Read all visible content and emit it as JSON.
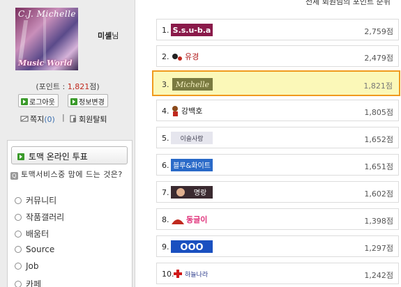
{
  "header": {
    "title": "전체 회원님의 포인트 순위"
  },
  "user": {
    "name": "미셸",
    "suffix": "님",
    "avatar_text_top": "C.J. Michelle",
    "avatar_text_bottom": "Music World"
  },
  "points": {
    "prefix": "(포인트 : ",
    "value": "1,821",
    "unit": "점)"
  },
  "buttons": {
    "logout": "로그아웃",
    "edit_info": "정보변경"
  },
  "links": {
    "memo": "쪽지",
    "memo_count": "(0)",
    "separator": "|",
    "withdraw": "회원탈퇴"
  },
  "poll": {
    "button": "토맥 온라인 투표",
    "question": "토맥서비스중 맘에 드는 것은?",
    "options": [
      "커뮤니티",
      "작품갤러리",
      "배움터",
      "Source",
      "Job",
      "카페"
    ]
  },
  "rankings": [
    {
      "rank": "1.",
      "nick": "S.s.u-b.a",
      "points": "2,759점"
    },
    {
      "rank": "2.",
      "nick": "유경",
      "points": "2,479점"
    },
    {
      "rank": "3.",
      "nick": "Michelle",
      "points": "1,821점"
    },
    {
      "rank": "4.",
      "nick": "강백호",
      "points": "1,805점"
    },
    {
      "rank": "5.",
      "nick": "이슬사랑",
      "points": "1,652점"
    },
    {
      "rank": "6.",
      "nick": "블루&화이트",
      "points": "1,651점"
    },
    {
      "rank": "7.",
      "nick": "명랑",
      "points": "1,602점"
    },
    {
      "rank": "8.",
      "nick": "동글이",
      "points": "1,398점"
    },
    {
      "rank": "9.",
      "nick": "OOO",
      "points": "1,297점"
    },
    {
      "rank": "10.",
      "nick": "하늘나라",
      "points": "1,242점"
    }
  ],
  "colors": {
    "highlight_border": "#f09a1e",
    "highlight_bg": "#fbf8b8",
    "points_red": "#c0291e"
  }
}
